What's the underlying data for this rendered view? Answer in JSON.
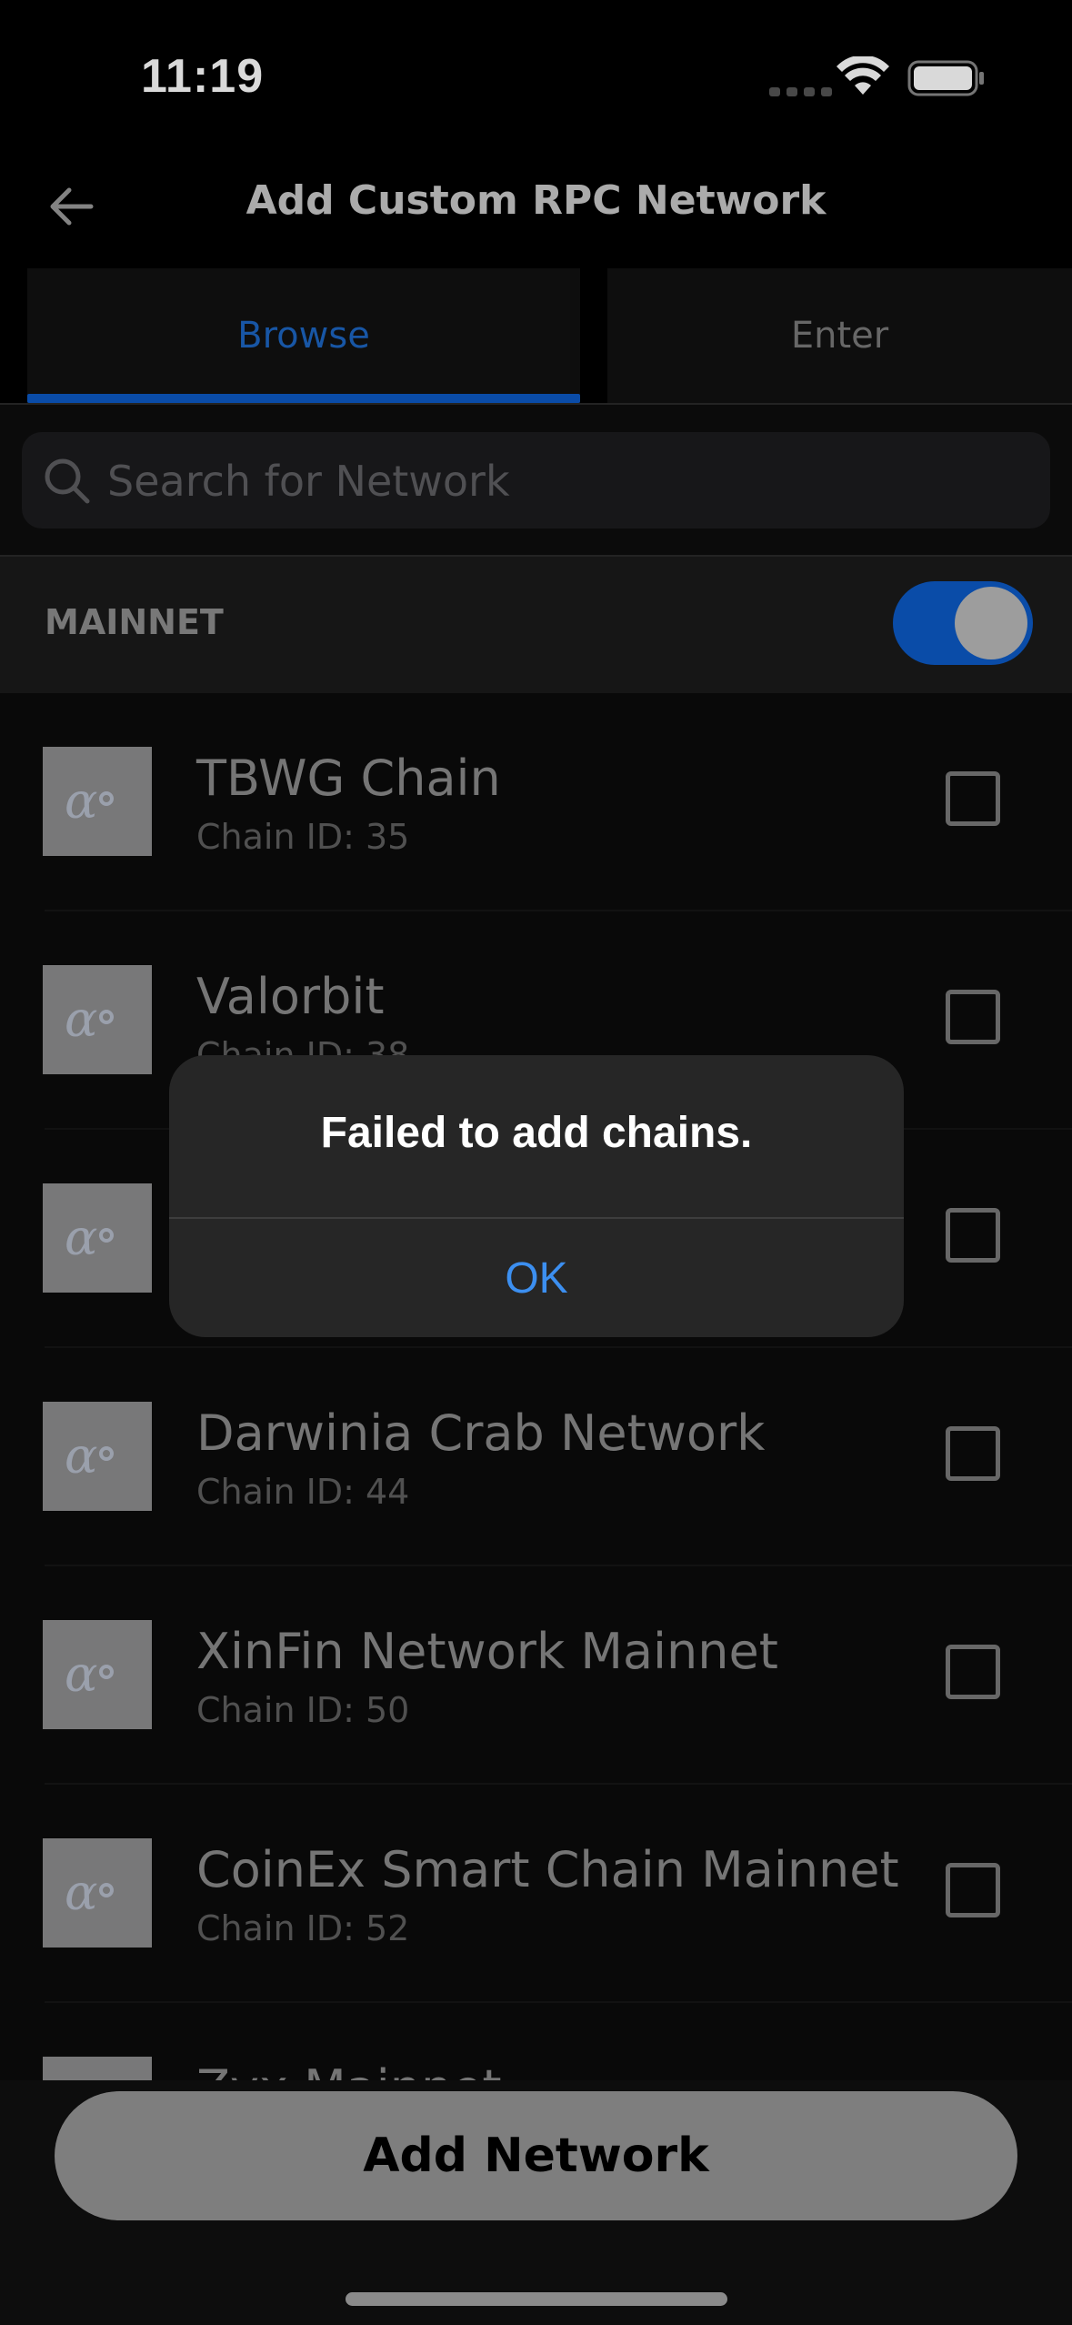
{
  "status_bar": {
    "time": "11:19"
  },
  "header": {
    "title": "Add Custom RPC Network",
    "back_icon": "arrow-left-icon"
  },
  "tabs": [
    {
      "label": "Browse",
      "active": true
    },
    {
      "label": "Enter",
      "active": false
    }
  ],
  "search": {
    "placeholder": "Search for Network",
    "value": ""
  },
  "section": {
    "label": "MAINNET",
    "toggle_on": true
  },
  "networks": [
    {
      "name": "TBWG Chain",
      "chain_id": "Chain ID: 35",
      "checked": false
    },
    {
      "name": "Valorbit",
      "chain_id": "Chain ID: 38",
      "checked": false
    },
    {
      "name": "",
      "chain_id": "",
      "checked": false
    },
    {
      "name": "Darwinia Crab Network",
      "chain_id": "Chain ID: 44",
      "checked": false
    },
    {
      "name": "XinFin Network Mainnet",
      "chain_id": "Chain ID: 50",
      "checked": false
    },
    {
      "name": "CoinEx Smart Chain Mainnet",
      "chain_id": "Chain ID: 52",
      "checked": false
    },
    {
      "name": "Zyx Mainnet",
      "chain_id": "",
      "checked": false
    }
  ],
  "bottom": {
    "add_label": "Add Network"
  },
  "alert": {
    "title": "Failed to add chains.",
    "ok_label": "OK"
  },
  "colors": {
    "accent": "#0c5ac6",
    "alert_button": "#3c8ff0"
  }
}
